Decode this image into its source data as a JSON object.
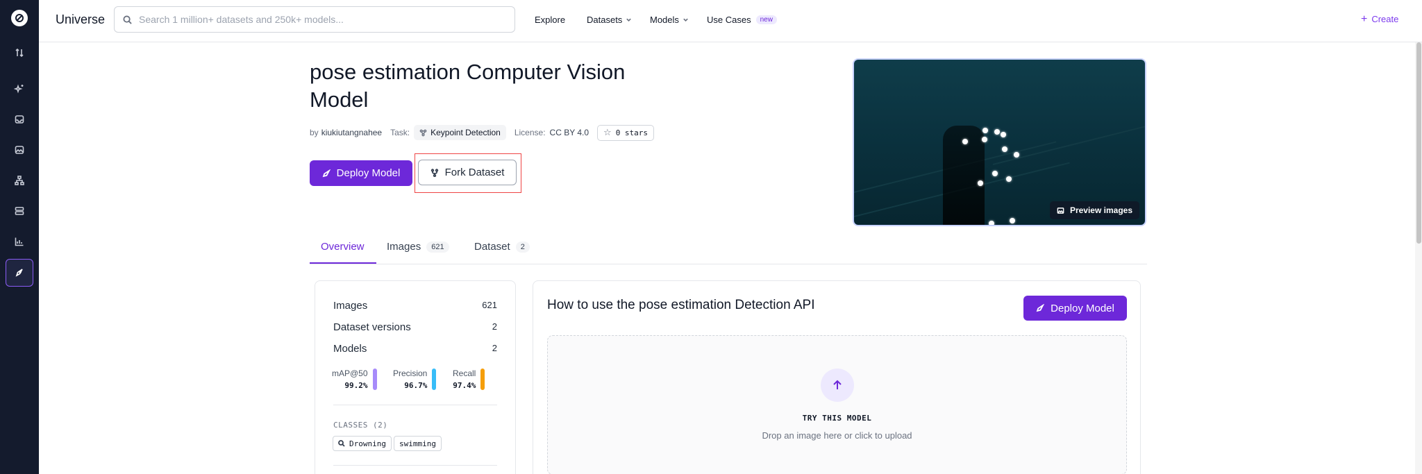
{
  "rail": {
    "logo_icon": "roboflow-logo-icon",
    "icons": [
      "sort-arrows-icon",
      "sparkle-icon",
      "inbox-icon",
      "image-icon",
      "workflow-icon",
      "database-icon",
      "chart-icon",
      "deploy-rocket-icon"
    ]
  },
  "topbar": {
    "brand": "Universe",
    "search_placeholder": "Search 1 million+ datasets and 250k+ models...",
    "nav": {
      "explore": "Explore",
      "datasets": "Datasets",
      "models": "Models",
      "use_cases": "Use Cases",
      "new_badge": "new"
    },
    "create": "Create"
  },
  "header": {
    "title": "pose estimation Computer Vision Model",
    "by_prefix": "by",
    "author": "kiukiutangnahee",
    "task_label": "Task:",
    "task_value": "Keypoint Detection",
    "license_label": "License:",
    "license_value": "CC BY 4.0",
    "stars": "0 stars",
    "deploy_button": "Deploy Model",
    "fork_button": "Fork Dataset",
    "preview_button": "Preview images"
  },
  "tabs": [
    {
      "label": "Overview",
      "count": ""
    },
    {
      "label": "Images",
      "count": "621"
    },
    {
      "label": "Dataset",
      "count": "2"
    }
  ],
  "stats": {
    "images_label": "Images",
    "images_value": "621",
    "versions_label": "Dataset versions",
    "versions_value": "2",
    "models_label": "Models",
    "models_value": "2",
    "metrics": [
      {
        "label": "mAP@50",
        "value": "99.2%",
        "color": "#a78bfa"
      },
      {
        "label": "Precision",
        "value": "96.7%",
        "color": "#38bdf8"
      },
      {
        "label": "Recall",
        "value": "97.4%",
        "color": "#f59e0b"
      }
    ],
    "classes_label": "CLASSES (2)",
    "classes": [
      "Drowning",
      "swimming"
    ]
  },
  "api": {
    "title": "How to use the pose estimation Detection API",
    "deploy_button": "Deploy Model",
    "try_label": "TRY THIS MODEL",
    "drop_hint": "Drop an image here or click to upload"
  },
  "colors": {
    "accent": "#6d28d9",
    "rail_bg": "#141b2d"
  }
}
